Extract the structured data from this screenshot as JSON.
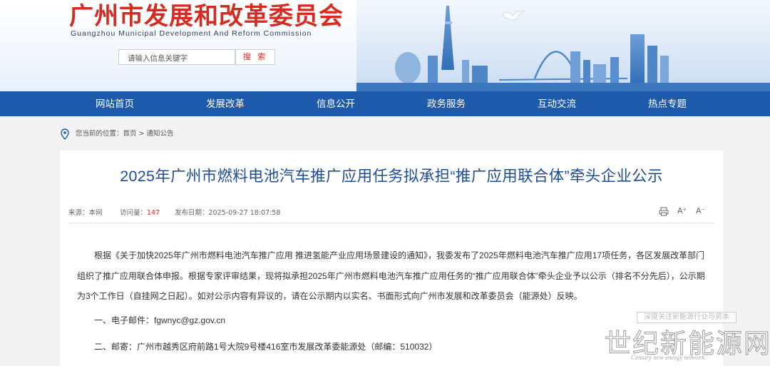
{
  "header": {
    "title": "广州市发展和改革委员会",
    "subtitle": "Guangzhou Municipal Development And Reform Commission",
    "search_placeholder": "请输入信息关键字",
    "search_button": "搜 索",
    "brand_color": "#d62b20"
  },
  "nav": {
    "color": "#1d5aab",
    "items": [
      "网站首页",
      "发展改革",
      "信息公开",
      "政务服务",
      "互动交流",
      "热点专题"
    ]
  },
  "breadcrumb": {
    "icon": "location-pin-icon",
    "text": "您当前的位置：首页 > 通知公告"
  },
  "article": {
    "title": "2025年广州市燃料电池汽车推广应用任务拟承担“推广应用联合体”牵头企业公示",
    "source": "来源：本网",
    "views_label": "访问量：",
    "views": "147",
    "published": "发布日期：2025-09-27 18:07:58",
    "tools": {
      "print_icon": "print-icon",
      "font_increase": "A⁺",
      "font_decrease": "A⁻"
    },
    "body": "根据《关于加快2025年广州市燃料电池汽车推广应用 推进氢能产业应用场景建设的通知》，我委发布了2025年燃料电池汽车推广应用17项任务，各区发展改革部门组织了推广应用联合体申报。根据专家评审结果，现将拟承担2025年广州市燃料电池汽车推广应用任务的“推广应用联合体”牵头企业予以公示（排名不分先后），公示期为3个工作日（自挂网之日起）。如对公示内容有异议的，请在公示期内以实名、书面形式向广州市发展和改革委员会（能源处）反映。",
    "contact_email": "一、电子邮件：fgwnyc@gz.gov.cn",
    "contact_mail": "二、邮寄：广州市越秀区府前路1号大院9号楼416室市发展改革委能源处（邮编：510032）"
  },
  "watermark": {
    "tagline": "深度关注新能源行业与资本",
    "name": "世纪新能源网",
    "english": "Century new energy network"
  }
}
